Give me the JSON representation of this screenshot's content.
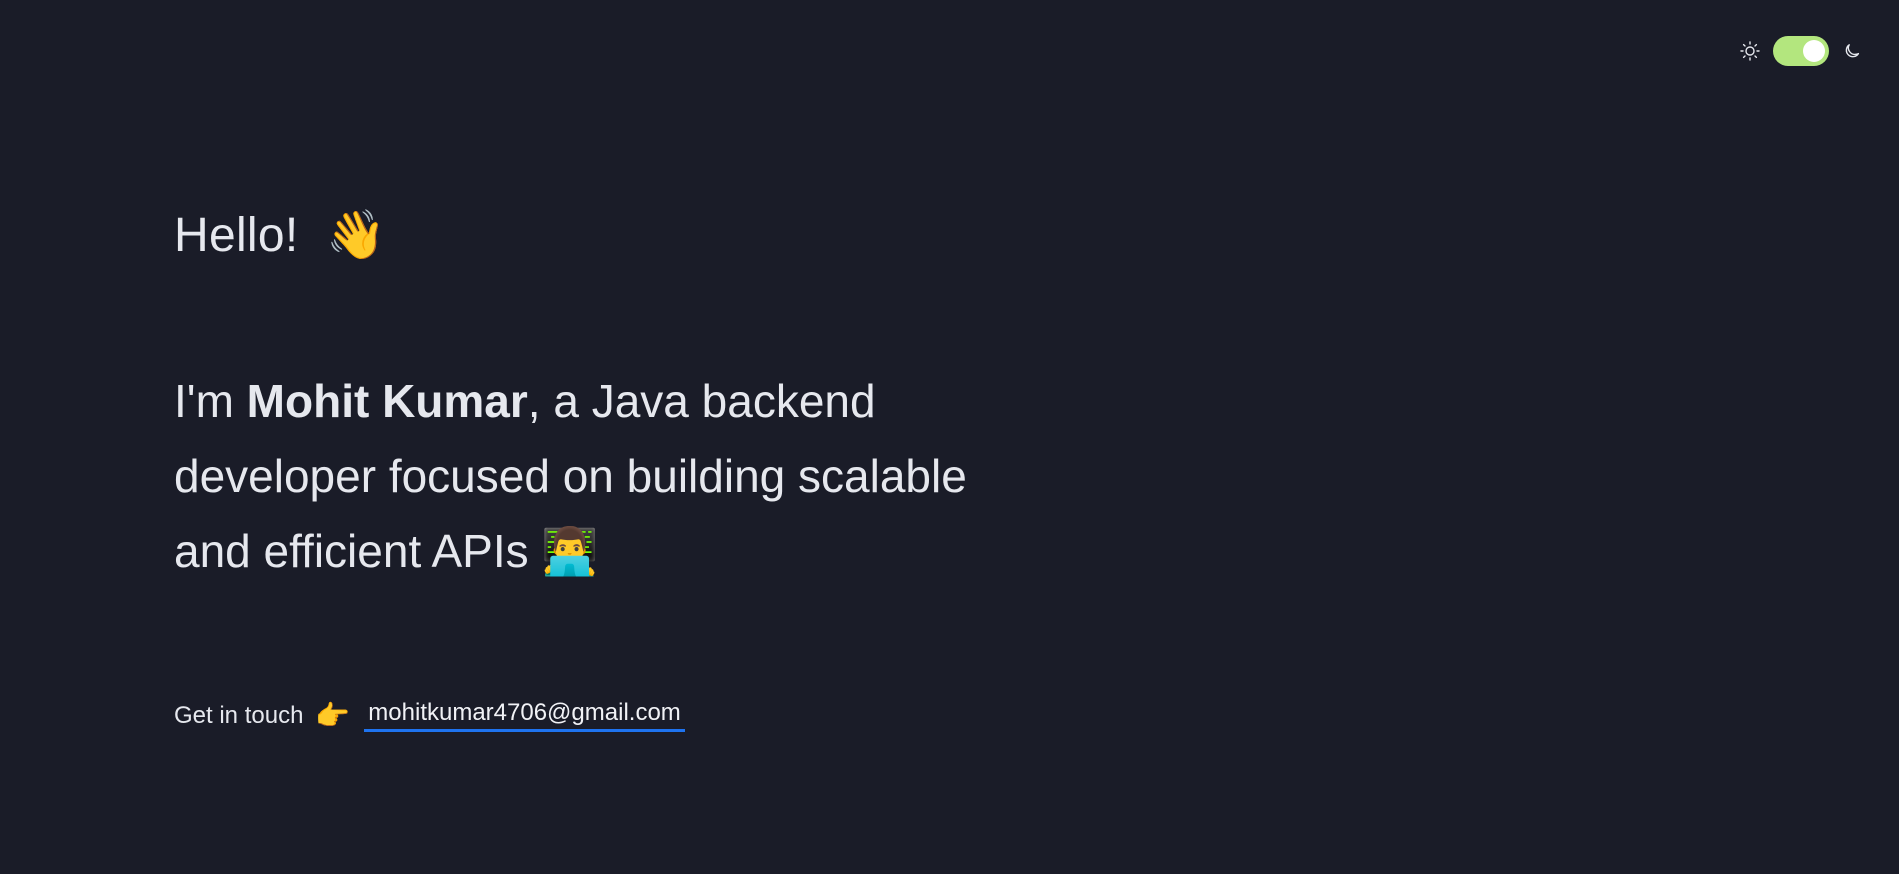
{
  "header": {
    "theme_toggle": {
      "sun_icon": "sun-icon",
      "moon_icon": "moon-icon",
      "state": "dark",
      "track_color": "#b3e67e",
      "knob_color": "#ffffff"
    }
  },
  "hero": {
    "greeting": "Hello!",
    "greeting_emoji": "👋",
    "intro_prefix": "I'm ",
    "name": "Mohit Kumar",
    "intro_suffix": ", a Java backend developer focused on building scalable and efficient APIs",
    "intro_emoji": "👨‍💻"
  },
  "contact": {
    "label": "Get in touch",
    "pointer_emoji": "👉",
    "email": "mohitkumar4706@gmail.com",
    "underline_color": "#1e73f0"
  },
  "colors": {
    "background": "#1a1c28",
    "text": "#e6e8ee"
  }
}
